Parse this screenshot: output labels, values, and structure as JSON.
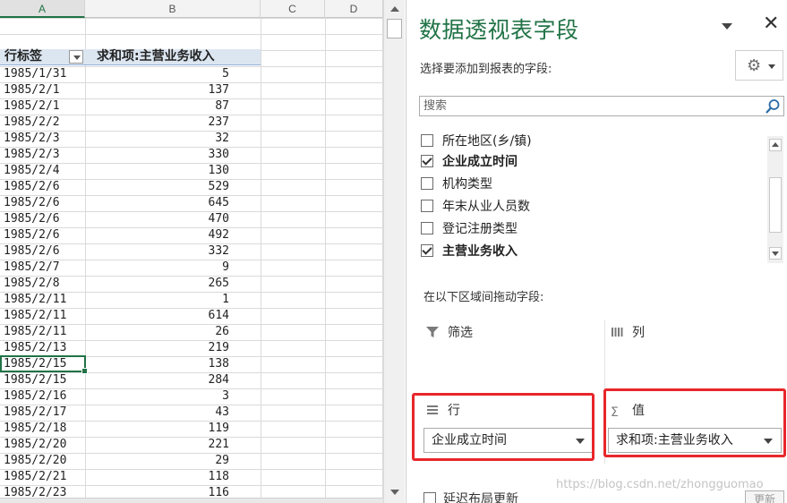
{
  "sheet": {
    "columns": [
      "A",
      "B",
      "C",
      "D"
    ],
    "pivot_header": {
      "row_label": "行标签",
      "value_label": "求和项:主营业务收入"
    },
    "rows": [
      {
        "label": "1985/1/31",
        "value": "5"
      },
      {
        "label": "1985/2/1",
        "value": "137"
      },
      {
        "label": "1985/2/1",
        "value": "87"
      },
      {
        "label": "1985/2/2",
        "value": "237"
      },
      {
        "label": "1985/2/3",
        "value": "32"
      },
      {
        "label": "1985/2/3",
        "value": "330"
      },
      {
        "label": "1985/2/4",
        "value": "130"
      },
      {
        "label": "1985/2/6",
        "value": "529"
      },
      {
        "label": "1985/2/6",
        "value": "645"
      },
      {
        "label": "1985/2/6",
        "value": "470"
      },
      {
        "label": "1985/2/6",
        "value": "492"
      },
      {
        "label": "1985/2/6",
        "value": "332"
      },
      {
        "label": "1985/2/7",
        "value": "9"
      },
      {
        "label": "1985/2/8",
        "value": "265"
      },
      {
        "label": "1985/2/11",
        "value": "1"
      },
      {
        "label": "1985/2/11",
        "value": "614"
      },
      {
        "label": "1985/2/11",
        "value": "26"
      },
      {
        "label": "1985/2/13",
        "value": "219"
      },
      {
        "label": "1985/2/15",
        "value": "138"
      },
      {
        "label": "1985/2/15",
        "value": "284"
      },
      {
        "label": "1985/2/16",
        "value": "3"
      },
      {
        "label": "1985/2/17",
        "value": "43"
      },
      {
        "label": "1985/2/18",
        "value": "119"
      },
      {
        "label": "1985/2/20",
        "value": "221"
      },
      {
        "label": "1985/2/20",
        "value": "29"
      },
      {
        "label": "1985/2/21",
        "value": "118"
      },
      {
        "label": "1985/2/23",
        "value": "116"
      }
    ]
  },
  "panel": {
    "title": "数据透视表字段",
    "choose_label": "选择要添加到报表的字段:",
    "search_placeholder": "搜索",
    "fields": [
      {
        "label": "所在地区(乡/镇)",
        "checked": false,
        "bold": false
      },
      {
        "label": "企业成立时间",
        "checked": true,
        "bold": true
      },
      {
        "label": "机构类型",
        "checked": false,
        "bold": false
      },
      {
        "label": "年末从业人员数",
        "checked": false,
        "bold": false
      },
      {
        "label": "登记注册类型",
        "checked": false,
        "bold": false
      },
      {
        "label": "主营业务收入",
        "checked": true,
        "bold": true
      }
    ],
    "drag_label": "在以下区域间拖动字段:",
    "areas": {
      "filter": {
        "title": "筛选"
      },
      "columns": {
        "title": "列"
      },
      "rows": {
        "title": "行",
        "item": "企业成立时间"
      },
      "values": {
        "title": "值",
        "item": "求和项:主营业务收入"
      }
    },
    "defer_label": "延迟布局更新",
    "update_label": "更新"
  },
  "watermark": "https://blog.csdn.net/zhongguomao",
  "colors": {
    "accent": "#217346",
    "highlight_box": "#e8262a",
    "pivot_header_bg": "#dce6f1"
  }
}
